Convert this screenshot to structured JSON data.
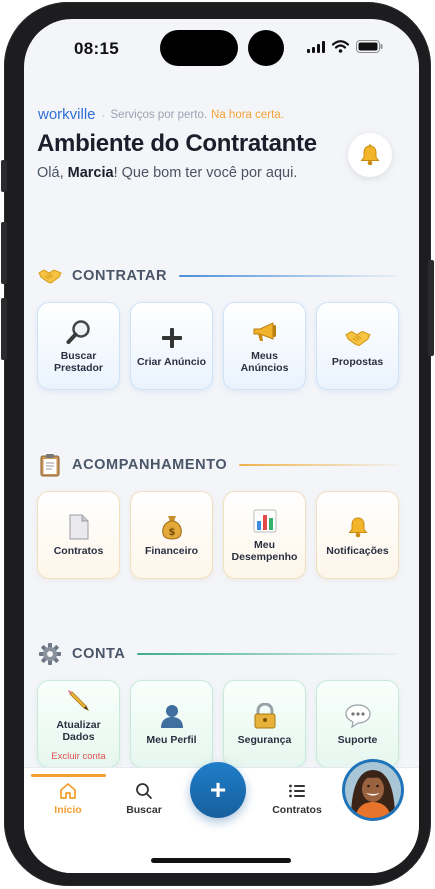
{
  "status_bar": {
    "time": "08:15"
  },
  "header": {
    "brand": "workville",
    "separator": "·",
    "tagline": "Serviços por perto.",
    "tagline_accent": "Na hora certa.",
    "title": "Ambiente do Contratante",
    "greeting_prefix": "Olá,",
    "user_name": "Marcia",
    "greeting_suffix": "! Que bom ter você por aqui."
  },
  "sections": [
    {
      "title": "CONTRATAR",
      "icon": "handshake-icon",
      "accent": "#4a90d9",
      "tiles": [
        {
          "label": "Buscar Prestador",
          "icon": "magnifier-icon"
        },
        {
          "label": "Criar Anúncio",
          "icon": "plus-icon"
        },
        {
          "label": "Meus Anúncios",
          "icon": "megaphone-icon"
        },
        {
          "label": "Propostas",
          "icon": "handshake-icon"
        }
      ]
    },
    {
      "title": "ACOMPANHAMENTO",
      "icon": "clipboard-icon",
      "accent": "#f0b24a",
      "tiles": [
        {
          "label": "Contratos",
          "icon": "document-icon"
        },
        {
          "label": "Financeiro",
          "icon": "money-bag-icon"
        },
        {
          "label": "Meu Desempenho",
          "icon": "bar-chart-icon"
        },
        {
          "label": "Notificações",
          "icon": "bell-icon"
        }
      ]
    },
    {
      "title": "CONTA",
      "icon": "gear-icon",
      "accent": "#3cae8a",
      "tiles": [
        {
          "label": "Atualizar Dados",
          "sublabel": "Excluir conta",
          "icon": "pencil-icon"
        },
        {
          "label": "Meu Perfil",
          "icon": "user-icon"
        },
        {
          "label": "Segurança",
          "icon": "lock-icon"
        },
        {
          "label": "Suporte",
          "icon": "chat-bubble-icon"
        }
      ]
    }
  ],
  "tabbar": {
    "tabs": [
      {
        "label": "Início",
        "icon": "home-icon",
        "active": true
      },
      {
        "label": "Buscar",
        "icon": "search-icon",
        "active": false
      },
      {
        "label": "Contratos",
        "icon": "list-icon",
        "active": false
      }
    ],
    "fab_label": "+",
    "fab_icon": "plus-icon",
    "avatar_icon": "user-avatar"
  },
  "colors": {
    "brand": "#2f6fd6",
    "accent_orange": "#f0a030",
    "fab": "#1f7ec9",
    "danger": "#e05050"
  }
}
